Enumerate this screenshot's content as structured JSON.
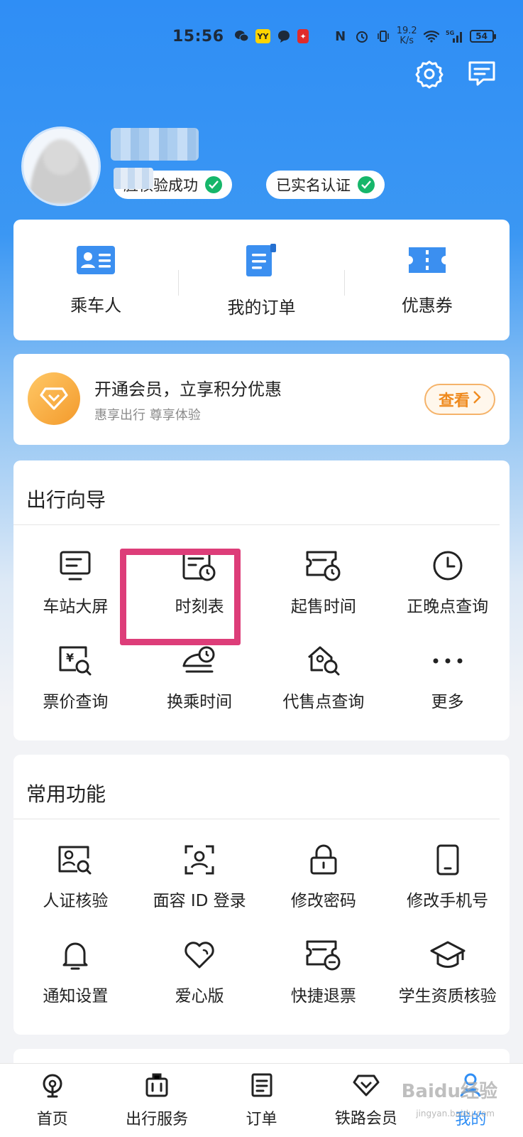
{
  "status_bar": {
    "time": "15:56",
    "speed_value": "19.2",
    "speed_unit": "K/s",
    "battery": "54",
    "network": "5G"
  },
  "profile": {
    "verify_tag": "脸核验成功",
    "realname_tag": "已实名认证"
  },
  "quick_actions": [
    {
      "label": "乘车人",
      "icon": "passenger-card-icon"
    },
    {
      "label": "我的订单",
      "icon": "order-document-icon"
    },
    {
      "label": "优惠券",
      "icon": "coupon-ticket-icon"
    }
  ],
  "member": {
    "title": "开通会员，立享积分优惠",
    "subtitle": "惠享出行 尊享体验",
    "button": "查看"
  },
  "guide": {
    "title": "出行向导",
    "items": [
      {
        "label": "车站大屏",
        "icon": "station-screen-icon"
      },
      {
        "label": "时刻表",
        "icon": "timetable-icon"
      },
      {
        "label": "起售时间",
        "icon": "sale-time-icon"
      },
      {
        "label": "正晚点查询",
        "icon": "clock-icon"
      },
      {
        "label": "票价查询",
        "icon": "fare-search-icon"
      },
      {
        "label": "换乘时间",
        "icon": "transfer-time-icon"
      },
      {
        "label": "代售点查询",
        "icon": "agency-search-icon"
      },
      {
        "label": "更多",
        "icon": "more-dots-icon"
      }
    ]
  },
  "common": {
    "title": "常用功能",
    "items": [
      {
        "label": "人证核验",
        "icon": "id-verify-icon"
      },
      {
        "label": "面容 ID 登录",
        "icon": "face-id-icon"
      },
      {
        "label": "修改密码",
        "icon": "lock-icon"
      },
      {
        "label": "修改手机号",
        "icon": "phone-icon"
      },
      {
        "label": "通知设置",
        "icon": "bell-icon"
      },
      {
        "label": "爱心版",
        "icon": "heart-icon"
      },
      {
        "label": "快捷退票",
        "icon": "refund-ticket-icon"
      },
      {
        "label": "学生资质核验",
        "icon": "graduation-cap-icon"
      }
    ]
  },
  "bottom_nav": [
    {
      "label": "首页",
      "icon": "train-home-icon",
      "active": false
    },
    {
      "label": "出行服务",
      "icon": "luggage-icon",
      "active": false
    },
    {
      "label": "订单",
      "icon": "order-icon",
      "active": false
    },
    {
      "label": "铁路会员",
      "icon": "diamond-icon",
      "active": false
    },
    {
      "label": "我的",
      "icon": "user-icon",
      "active": true
    }
  ],
  "watermark": {
    "text": "Baidu经验",
    "sub": "jingyan.baidu.com"
  },
  "colors": {
    "primary": "#2f8ef5",
    "highlight": "#dd3d79",
    "check": "#16b66a",
    "member_orange": "#ef8a1e"
  }
}
